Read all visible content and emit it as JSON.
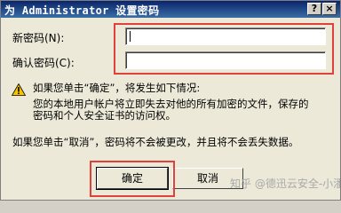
{
  "window": {
    "title": "为 Administrator 设置密码",
    "help_label": "?",
    "close_label": "×"
  },
  "form": {
    "new_password_label": "新密码(N):",
    "new_password_value": "",
    "confirm_password_label": "确认密码(C):",
    "confirm_password_value": ""
  },
  "warning": {
    "line1": "如果您单击“确定”，将发生如下情况:",
    "line2": "您的本地用户帐户将立即失去对他的所有加密的文件，保存的",
    "line3": "密码和个人安全证书的访问权。"
  },
  "cancel_note": "如果您单击“取消”，密码将不会被更改，并且将不会丢失数据。",
  "buttons": {
    "ok_label": "确定",
    "cancel_label": "取消"
  },
  "watermark": "知乎 @德迅云安全-小潘",
  "colors": {
    "highlight": "#e0413a",
    "titlebar": "#0a246a",
    "window_bg": "#ece9d8"
  }
}
